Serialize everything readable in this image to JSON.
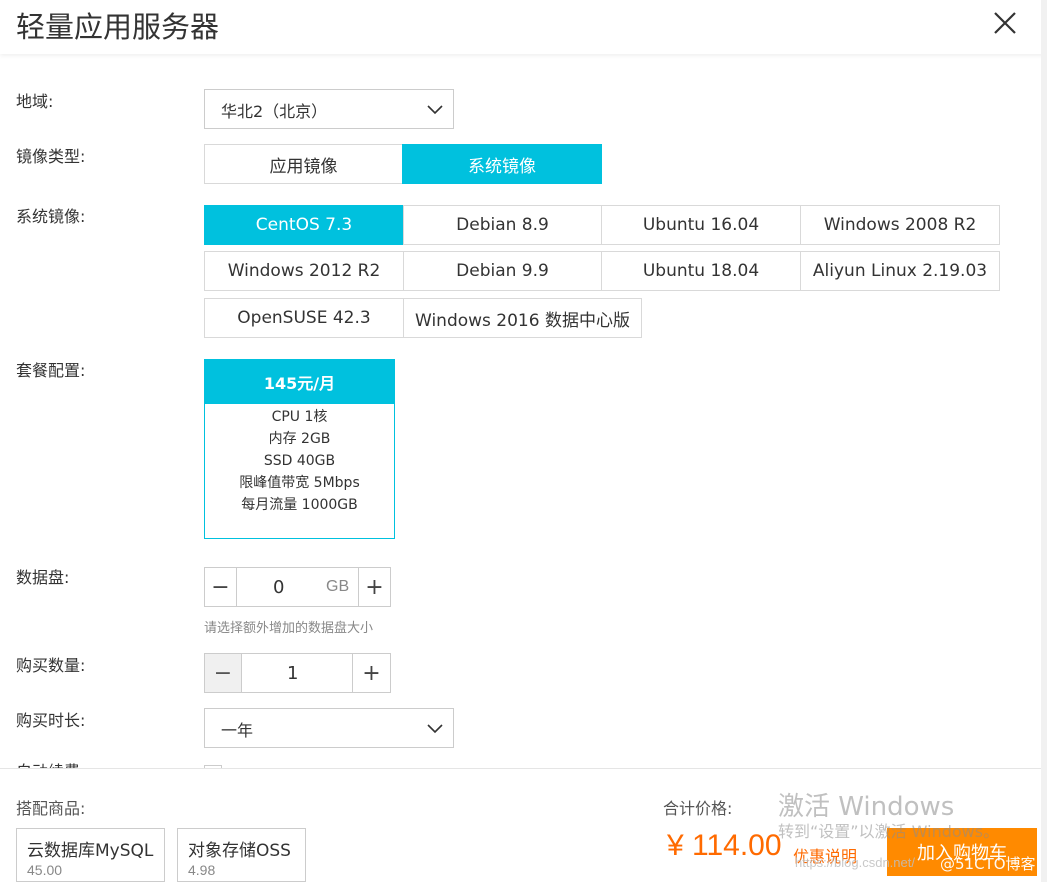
{
  "header": {
    "title": "轻量应用服务器",
    "close_icon": "close-icon"
  },
  "region": {
    "label": "地域:",
    "selected": "华北2（北京）"
  },
  "image_type": {
    "label": "镜像类型:",
    "options": [
      "应用镜像",
      "系统镜像"
    ],
    "selected": "系统镜像"
  },
  "system_image": {
    "label": "系统镜像:",
    "options": [
      "CentOS 7.3",
      "Debian 8.9",
      "Ubuntu 16.04",
      "Windows 2008 R2",
      "Windows 2012 R2",
      "Debian 9.9",
      "Ubuntu 18.04",
      "Aliyun Linux 2.19.03",
      "OpenSUSE 42.3",
      "Windows 2016 数据中心版"
    ],
    "selected": "CentOS 7.3"
  },
  "package": {
    "label": "套餐配置:",
    "price": "145元/月",
    "specs": [
      "CPU 1核",
      "内存 2GB",
      "SSD 40GB",
      "限峰值带宽 5Mbps",
      "每月流量 1000GB"
    ]
  },
  "data_disk": {
    "label": "数据盘:",
    "value": "0",
    "unit": "GB",
    "hint": "请选择额外增加的数据盘大小"
  },
  "quantity": {
    "label": "购买数量:",
    "value": "1"
  },
  "duration": {
    "label": "购买时长:",
    "selected": "一年"
  },
  "auto_renew": {
    "label": "自动续费"
  },
  "footer": {
    "addons_label": "搭配商品:",
    "addons": [
      {
        "name": "云数据库MySQL",
        "price": "45.00"
      },
      {
        "name": "对象存储OSS",
        "price": "4.98"
      }
    ],
    "total_label": "合计价格:",
    "total_price": "¥ 114.00",
    "discount_link": "优惠说明",
    "cart_button": "加入购物车"
  },
  "watermark": {
    "title": "激活 Windows",
    "subtitle": "转到“设置”以激活 Windows。",
    "url": "https://blog.csdn.net/",
    "site": "@51CTO博客"
  },
  "colors": {
    "accent": "#00c1de",
    "price": "#ff6a00",
    "cart": "#ff8a00"
  }
}
